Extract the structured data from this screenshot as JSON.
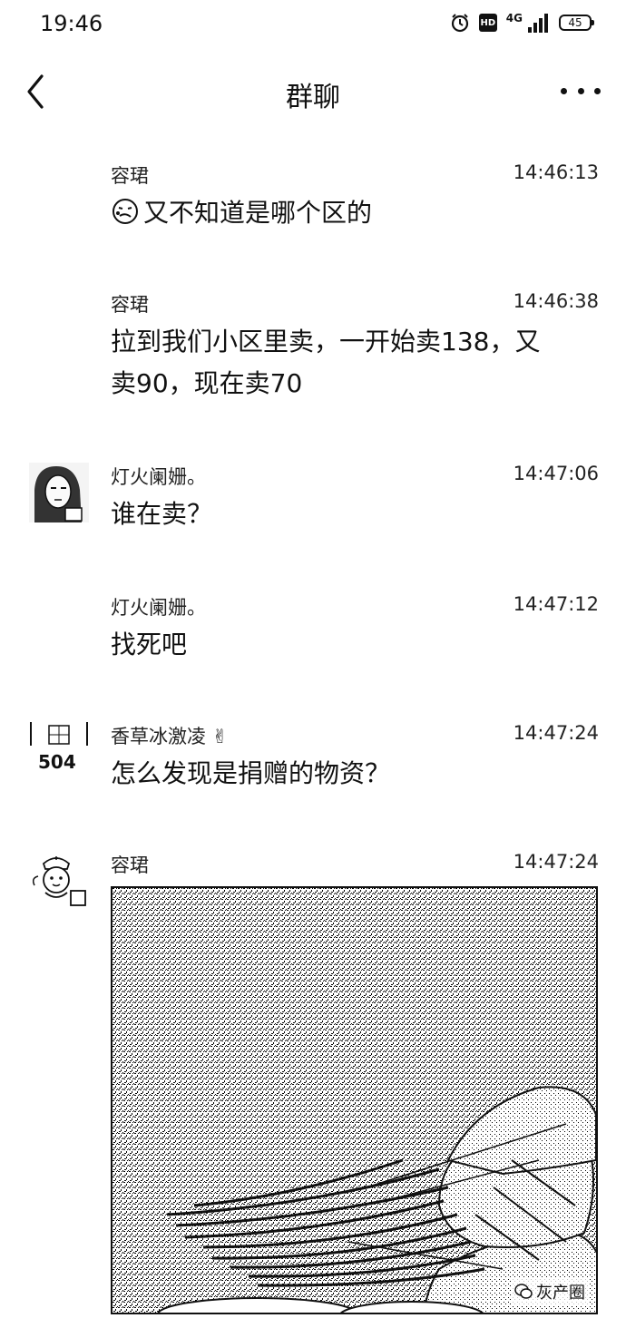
{
  "status_bar": {
    "time": "19:46",
    "network": "4G",
    "hd": "HD",
    "battery": "45"
  },
  "header": {
    "title": "群聊",
    "back_icon": "chevron-left-icon",
    "more_icon": "more-dots-icon"
  },
  "messages": [
    {
      "sender": "容珺",
      "time": "14:46:13",
      "text": "又不知道是哪个区的",
      "emoji": "face-emoji"
    },
    {
      "sender": "容珺",
      "time": "14:46:38",
      "text": "拉到我们小区里卖，一开始卖138，又卖90，现在卖70"
    },
    {
      "sender": "灯火阑姗。",
      "time": "14:47:06",
      "text": "谁在卖？"
    },
    {
      "sender": "灯火阑姗。",
      "time": "14:47:12",
      "text": "找死吧"
    },
    {
      "sender": "香草冰激凌 ✌",
      "time": "14:47:24",
      "text": "怎么发现是捐赠的物资？",
      "avatar_text": "504"
    },
    {
      "sender": "容珺",
      "time": "14:47:24",
      "image": "photo-vegetables"
    }
  ],
  "watermark": "灰产圈"
}
